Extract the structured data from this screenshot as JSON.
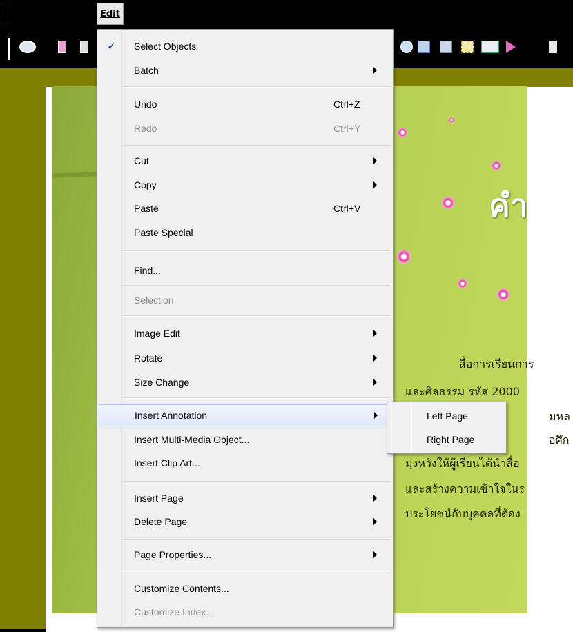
{
  "menubar": {
    "edit_label": "Edit"
  },
  "edit_menu": {
    "items": [
      {
        "label": "Select Objects",
        "checked": true
      },
      {
        "label": "Batch",
        "submenu": true
      },
      {
        "label": "Undo",
        "shortcut": "Ctrl+Z"
      },
      {
        "label": "Redo",
        "shortcut": "Ctrl+Y",
        "disabled": true
      },
      {
        "label": "Cut",
        "submenu": true
      },
      {
        "label": "Copy",
        "submenu": true
      },
      {
        "label": "Paste",
        "shortcut": "Ctrl+V"
      },
      {
        "label": "Paste Special"
      },
      {
        "label": "Find..."
      },
      {
        "label": "Selection",
        "disabled": true
      },
      {
        "label": "Image Edit",
        "submenu": true
      },
      {
        "label": "Rotate",
        "submenu": true
      },
      {
        "label": "Size Change",
        "submenu": true
      },
      {
        "label": "Insert Annotation",
        "submenu": true,
        "highlighted": true
      },
      {
        "label": "Insert Multi-Media Object..."
      },
      {
        "label": "Insert Clip Art..."
      },
      {
        "label": "Insert Page",
        "submenu": true
      },
      {
        "label": "Delete Page",
        "submenu": true
      },
      {
        "label": "Page Properties...",
        "submenu": true
      },
      {
        "label": "Customize Contents..."
      },
      {
        "label": "Customize Index...",
        "disabled": true
      }
    ],
    "check_glyph": "✓"
  },
  "annotation_submenu": {
    "items": [
      {
        "label": "Left Page"
      },
      {
        "label": "Right Page"
      }
    ]
  },
  "page": {
    "title_text": "คำ",
    "lines": [
      "สื่อการเรียนการ",
      "และศิลธรรม รหัส 2000",
      "มหล",
      "อศึก",
      "มุ่งหวังให้ผู้เรียนได้นำสื่อ",
      "และสร้างความเข้าใจในร",
      "ประโยชน์กับบุคคลที่ต้อง"
    ]
  },
  "colors": {
    "workspace": "#7f7f00",
    "menu_bg": "#f0f0f0",
    "highlight_border": "#a8c7ef"
  }
}
